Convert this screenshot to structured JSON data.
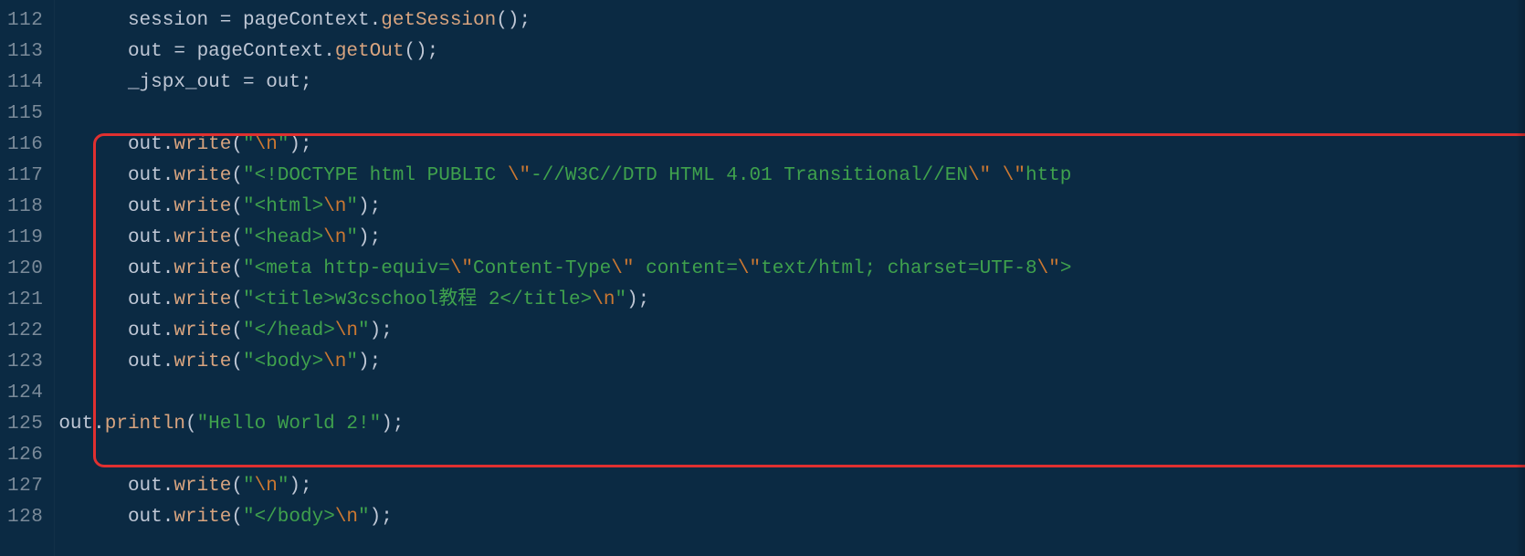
{
  "gutter": {
    "start": 112,
    "end": 128
  },
  "lines": {
    "112": {
      "indent": "      ",
      "seg": [
        [
          "session ",
          "d"
        ],
        [
          "= ",
          "d"
        ],
        [
          "pageContext",
          "d"
        ],
        [
          ".",
          "d"
        ],
        [
          "getSession",
          "m"
        ],
        [
          "();",
          "d"
        ]
      ]
    },
    "113": {
      "indent": "      ",
      "seg": [
        [
          "out ",
          "d"
        ],
        [
          "= ",
          "d"
        ],
        [
          "pageContext",
          "d"
        ],
        [
          ".",
          "d"
        ],
        [
          "getOut",
          "m"
        ],
        [
          "();",
          "d"
        ]
      ]
    },
    "114": {
      "indent": "      ",
      "seg": [
        [
          "_jspx_out ",
          "d"
        ],
        [
          "= ",
          "d"
        ],
        [
          "out;",
          "d"
        ]
      ]
    },
    "115": {
      "indent": "",
      "seg": []
    },
    "116": {
      "indent": "      ",
      "seg": [
        [
          "out",
          "d"
        ],
        [
          ".",
          "d"
        ],
        [
          "write",
          "m"
        ],
        [
          "(",
          "d"
        ],
        [
          "\"",
          "s"
        ],
        [
          "\\n",
          "e"
        ],
        [
          "\"",
          "s"
        ],
        [
          ");",
          "d"
        ]
      ]
    },
    "117": {
      "indent": "      ",
      "seg": [
        [
          "out",
          "d"
        ],
        [
          ".",
          "d"
        ],
        [
          "write",
          "m"
        ],
        [
          "(",
          "d"
        ],
        [
          "\"<!DOCTYPE html PUBLIC ",
          "s"
        ],
        [
          "\\\"",
          "e"
        ],
        [
          "-//W3C//DTD HTML 4.01 Transitional//EN",
          "s"
        ],
        [
          "\\\"",
          "e"
        ],
        [
          " ",
          "s"
        ],
        [
          "\\\"",
          "e"
        ],
        [
          "http",
          "s"
        ]
      ]
    },
    "118": {
      "indent": "      ",
      "seg": [
        [
          "out",
          "d"
        ],
        [
          ".",
          "d"
        ],
        [
          "write",
          "m"
        ],
        [
          "(",
          "d"
        ],
        [
          "\"<html>",
          "s"
        ],
        [
          "\\n",
          "e"
        ],
        [
          "\"",
          "s"
        ],
        [
          ");",
          "d"
        ]
      ]
    },
    "119": {
      "indent": "      ",
      "seg": [
        [
          "out",
          "d"
        ],
        [
          ".",
          "d"
        ],
        [
          "write",
          "m"
        ],
        [
          "(",
          "d"
        ],
        [
          "\"<head>",
          "s"
        ],
        [
          "\\n",
          "e"
        ],
        [
          "\"",
          "s"
        ],
        [
          ");",
          "d"
        ]
      ]
    },
    "120": {
      "indent": "      ",
      "seg": [
        [
          "out",
          "d"
        ],
        [
          ".",
          "d"
        ],
        [
          "write",
          "m"
        ],
        [
          "(",
          "d"
        ],
        [
          "\"<meta http-equiv=",
          "s"
        ],
        [
          "\\\"",
          "e"
        ],
        [
          "Content-Type",
          "s"
        ],
        [
          "\\\"",
          "e"
        ],
        [
          " content=",
          "s"
        ],
        [
          "\\\"",
          "e"
        ],
        [
          "text/html; charset=UTF-8",
          "s"
        ],
        [
          "\\\"",
          "e"
        ],
        [
          ">",
          "s"
        ]
      ]
    },
    "121": {
      "indent": "      ",
      "seg": [
        [
          "out",
          "d"
        ],
        [
          ".",
          "d"
        ],
        [
          "write",
          "m"
        ],
        [
          "(",
          "d"
        ],
        [
          "\"<title>w3cschool教程 2</title>",
          "s"
        ],
        [
          "\\n",
          "e"
        ],
        [
          "\"",
          "s"
        ],
        [
          ");",
          "d"
        ]
      ]
    },
    "122": {
      "indent": "      ",
      "seg": [
        [
          "out",
          "d"
        ],
        [
          ".",
          "d"
        ],
        [
          "write",
          "m"
        ],
        [
          "(",
          "d"
        ],
        [
          "\"</head>",
          "s"
        ],
        [
          "\\n",
          "e"
        ],
        [
          "\"",
          "s"
        ],
        [
          ");",
          "d"
        ]
      ]
    },
    "123": {
      "indent": "      ",
      "seg": [
        [
          "out",
          "d"
        ],
        [
          ".",
          "d"
        ],
        [
          "write",
          "m"
        ],
        [
          "(",
          "d"
        ],
        [
          "\"<body>",
          "s"
        ],
        [
          "\\n",
          "e"
        ],
        [
          "\"",
          "s"
        ],
        [
          ");",
          "d"
        ]
      ]
    },
    "124": {
      "indent": "",
      "seg": []
    },
    "125": {
      "indent": "",
      "seg": [
        [
          "out",
          "d"
        ],
        [
          ".",
          "d"
        ],
        [
          "println",
          "m"
        ],
        [
          "(",
          "d"
        ],
        [
          "\"Hello World 2!\"",
          "s"
        ],
        [
          ");",
          "d"
        ]
      ]
    },
    "126": {
      "indent": "",
      "seg": []
    },
    "127": {
      "indent": "      ",
      "seg": [
        [
          "out",
          "d"
        ],
        [
          ".",
          "d"
        ],
        [
          "write",
          "m"
        ],
        [
          "(",
          "d"
        ],
        [
          "\"",
          "s"
        ],
        [
          "\\n",
          "e"
        ],
        [
          "\"",
          "s"
        ],
        [
          ");",
          "d"
        ]
      ]
    },
    "128": {
      "indent": "      ",
      "seg": [
        [
          "out",
          "d"
        ],
        [
          ".",
          "d"
        ],
        [
          "write",
          "m"
        ],
        [
          "(",
          "d"
        ],
        [
          "\"</body>",
          "s"
        ],
        [
          "\\n",
          "e"
        ],
        [
          "\"",
          "s"
        ],
        [
          ");",
          "d"
        ]
      ]
    }
  },
  "tokenClasses": {
    "d": "tok-default",
    "m": "tok-method",
    "s": "tok-str",
    "e": "tok-esc"
  }
}
